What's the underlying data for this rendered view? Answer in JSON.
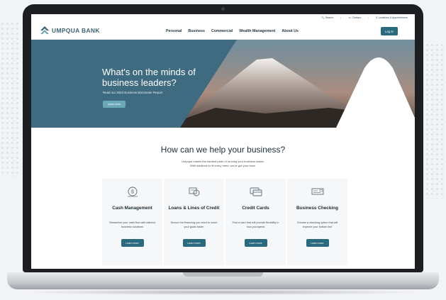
{
  "utility": {
    "search": "Search",
    "contact": "Contact",
    "locations": "Locations & Appointments"
  },
  "brand": {
    "name": "UMPQUA BANK",
    "color": "#3c6073"
  },
  "nav": {
    "items": [
      "Personal",
      "Business",
      "Commercial",
      "Wealth Management",
      "About Us"
    ],
    "login": "Log In"
  },
  "hero": {
    "title": "What's on the minds of business leaders?",
    "subtitle": "Read our 2023 Business Barometer Report",
    "button": "Learn more",
    "panel_color": "#3f6b80"
  },
  "help": {
    "title": "How can we help your business?",
    "line1": "Umpqua makes the hardest parts of running your business easier.",
    "line2": "With solutions to fit every need, we've got your back."
  },
  "cards": [
    {
      "title": "Cash Management",
      "desc": "Streamline your cash flow with tailored business solutions",
      "button": "Learn more",
      "icon": "cash-icon"
    },
    {
      "title": "Loans & Lines of Credit",
      "desc": "Secure the financing you need to reach your goals faster",
      "button": "Learn more",
      "icon": "loan-icon"
    },
    {
      "title": "Credit Cards",
      "desc": "Find a card that will provide flexibility in how you spend",
      "button": "Learn more",
      "icon": "credit-card-icon"
    },
    {
      "title": "Business Checking",
      "desc": "Choose a checking option that will improve your bottom line",
      "button": "Learn more",
      "icon": "checking-icon"
    }
  ],
  "accent": "#2a6a7e"
}
